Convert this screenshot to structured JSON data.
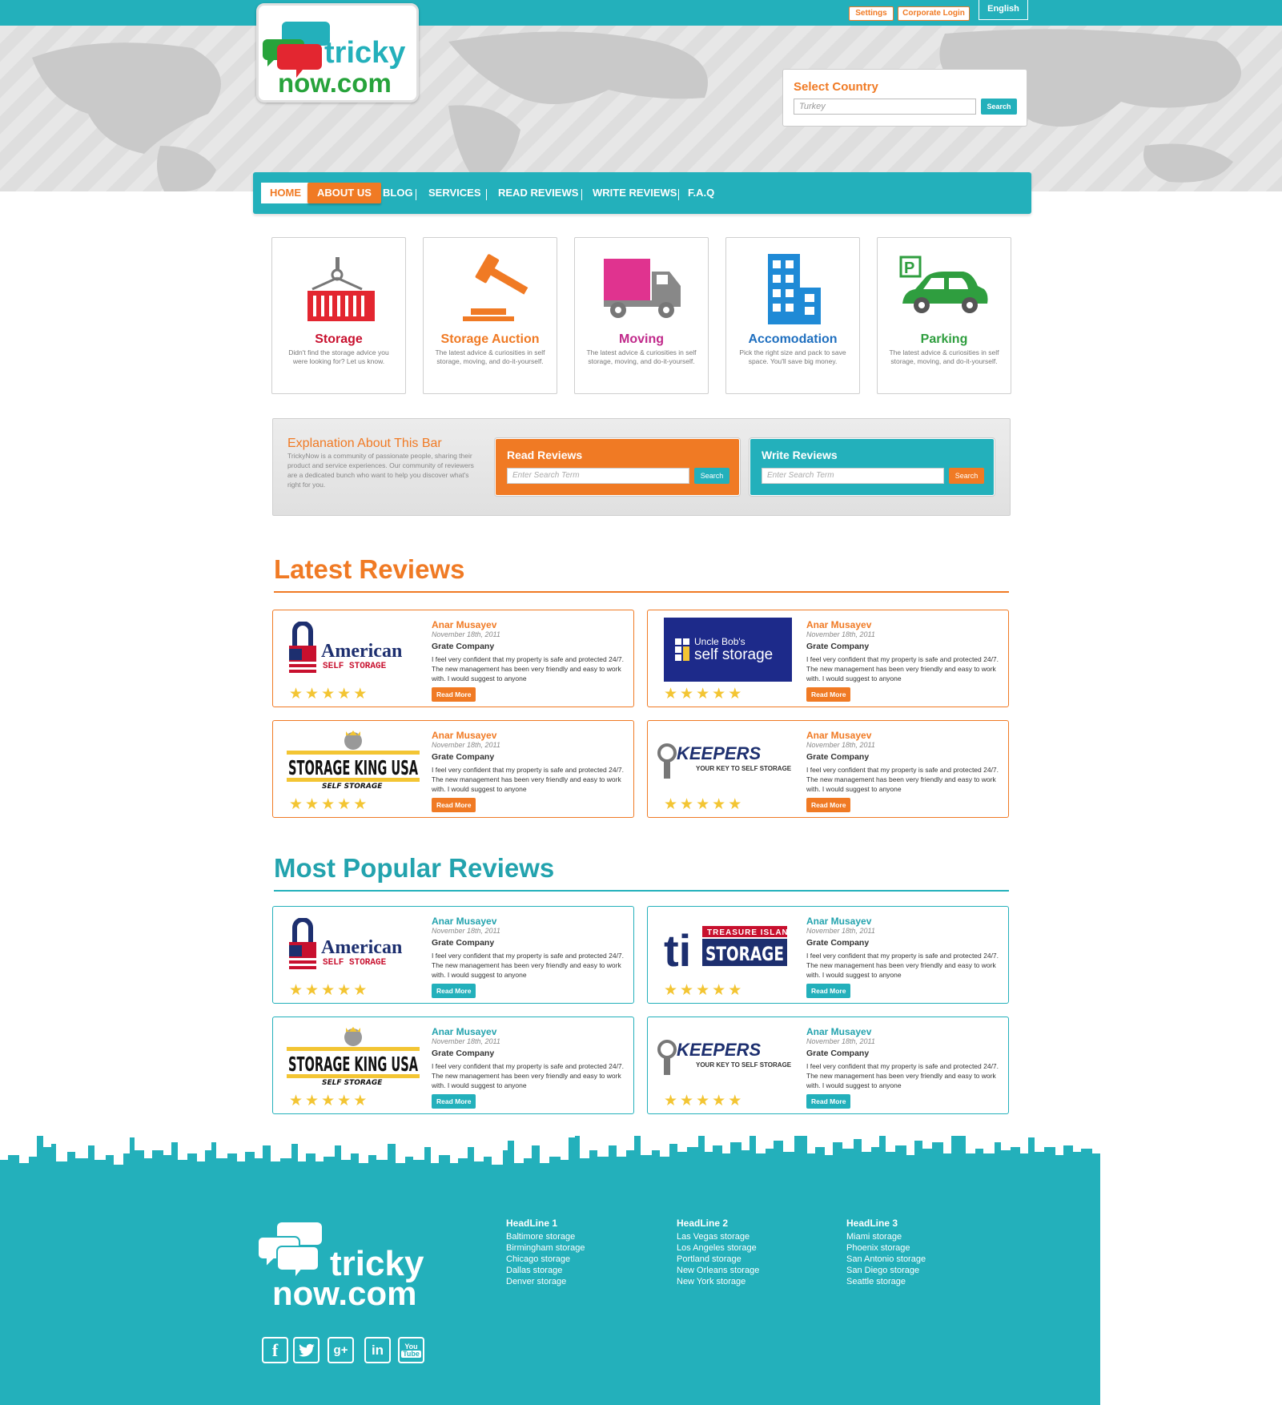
{
  "colors": {
    "teal": "#23b0bb",
    "orange": "#f07a24"
  },
  "topbar": {
    "settings": "Settings",
    "corporate_login": "Corporate Login",
    "language": "English"
  },
  "logo": {
    "line1": "tricky",
    "line2": "now.com"
  },
  "country": {
    "label": "Select Country",
    "value": "Turkey",
    "button": "Search"
  },
  "nav": {
    "items": [
      "HOME",
      "ABOUT US",
      "BLOG",
      "SERVICES",
      "READ REVIEWS",
      "WRITE REVIEWS",
      "F.A.Q"
    ]
  },
  "categories": [
    {
      "title": "Storage",
      "desc": "Didn't find the storage advice you were looking for? Let us know.",
      "color": "#c8102e",
      "icon": "storage-container-icon"
    },
    {
      "title": "Storage Auction",
      "desc": "The latest advice & curiosities in self storage, moving, and do-it-yourself.",
      "color": "#f07a24",
      "icon": "gavel-icon"
    },
    {
      "title": "Moving",
      "desc": "The latest advice & curiosities in self storage, moving, and do-it-yourself.",
      "color": "#c0288a",
      "icon": "truck-icon"
    },
    {
      "title": "Accomodation",
      "desc": "Pick the right size and pack to save space. You'll save big money.",
      "color": "#1f6fbf",
      "icon": "building-icon"
    },
    {
      "title": "Parking",
      "desc": "The latest advice & curiosities in self storage, moving, and do-it-yourself.",
      "color": "#2f9e3f",
      "icon": "car-parking-icon"
    }
  ],
  "explain": {
    "title": "Explanation About This Bar",
    "body": "TrickyNow is a community of passionate people, sharing their product and service experiences. Our community of reviewers are a dedicated bunch who want to help you discover what's right for you."
  },
  "read_reviews": {
    "label": "Read Reviews",
    "placeholder": "Enter Search Term",
    "button": "Search"
  },
  "write_reviews": {
    "label": "Write Reviews",
    "placeholder": "Enter Search Term",
    "button": "Search"
  },
  "latest": {
    "title": "Latest Reviews",
    "cards": [
      {
        "brand": "American Self Storage",
        "name": "Anar Musayev",
        "date": "November 18th, 2011",
        "company": "Grate Company",
        "text": "I feel very confident that my property is safe and protected 24/7. The new management has been very friendly and easy to work with. I would suggest to anyone",
        "rating": 5,
        "button": "Read More"
      },
      {
        "brand": "Uncle Bob's self storage",
        "name": "Anar Musayev",
        "date": "November 18th, 2011",
        "company": "Grate Company",
        "text": "I feel very confident that my property is safe and protected 24/7. The new management has been very friendly and easy to work with. I would suggest to anyone",
        "rating": 5,
        "button": "Read More"
      },
      {
        "brand": "Storage King USA Self Storage",
        "name": "Anar Musayev",
        "date": "November 18th, 2011",
        "company": "Grate Company",
        "text": "I feel very confident that my property is safe and protected 24/7. The new management has been very friendly and easy to work with. I would suggest to anyone",
        "rating": 5,
        "button": "Read More"
      },
      {
        "brand": "Keepers Your Key To Self Storage",
        "name": "Anar Musayev",
        "date": "November 18th, 2011",
        "company": "Grate Company",
        "text": "I feel very confident that my property is safe and protected 24/7. The new management has been very friendly and easy to work with. I would suggest to anyone",
        "rating": 5,
        "button": "Read More"
      }
    ]
  },
  "popular": {
    "title": "Most Popular Reviews",
    "cards": [
      {
        "brand": "American Self Storage",
        "name": "Anar Musayev",
        "date": "November 18th, 2011",
        "company": "Grate Company",
        "text": "I feel very confident that my property is safe and protected 24/7. The new management has been very friendly and easy to work with. I would suggest to anyone",
        "rating": 5,
        "button": "Read More"
      },
      {
        "brand": "Treasure Island Storage",
        "name": "Anar Musayev",
        "date": "November 18th, 2011",
        "company": "Grate Company",
        "text": "I feel very confident that my property is safe and protected 24/7. The new management has been very friendly and easy to work with. I would suggest to anyone",
        "rating": 5,
        "button": "Read More"
      },
      {
        "brand": "Storage King USA Self Storage",
        "name": "Anar Musayev",
        "date": "November 18th, 2011",
        "company": "Grate Company",
        "text": "I feel very confident that my property is safe and protected 24/7. The new management has been very friendly and easy to work with. I would suggest to anyone",
        "rating": 5,
        "button": "Read More"
      },
      {
        "brand": "Keepers Your Key To Self Storage",
        "name": "Anar Musayev",
        "date": "November 18th, 2011",
        "company": "Grate Company",
        "text": "I feel very confident that my property is safe and protected 24/7. The new management has been very friendly and easy to work with. I would suggest to anyone",
        "rating": 5,
        "button": "Read More"
      }
    ]
  },
  "footer": {
    "logo": {
      "line1": "tricky",
      "line2": "now.com"
    },
    "columns": [
      {
        "title": "HeadLine 1",
        "links": [
          "Baltimore storage",
          "Birmingham storage",
          "Chicago storage",
          "Dallas storage",
          "Denver storage"
        ]
      },
      {
        "title": "HeadLine 2",
        "links": [
          "Las Vegas storage",
          "Los Angeles storage",
          "Portland storage",
          "New Orleans storage",
          "New York storage"
        ]
      },
      {
        "title": "HeadLine 3",
        "links": [
          "Miami storage",
          "Phoenix storage",
          "San Antonio storage",
          "San Diego storage",
          "Seattle storage"
        ]
      }
    ],
    "social": [
      "facebook-icon",
      "twitter-icon",
      "google-plus-icon",
      "linkedin-icon",
      "youtube-icon"
    ]
  }
}
